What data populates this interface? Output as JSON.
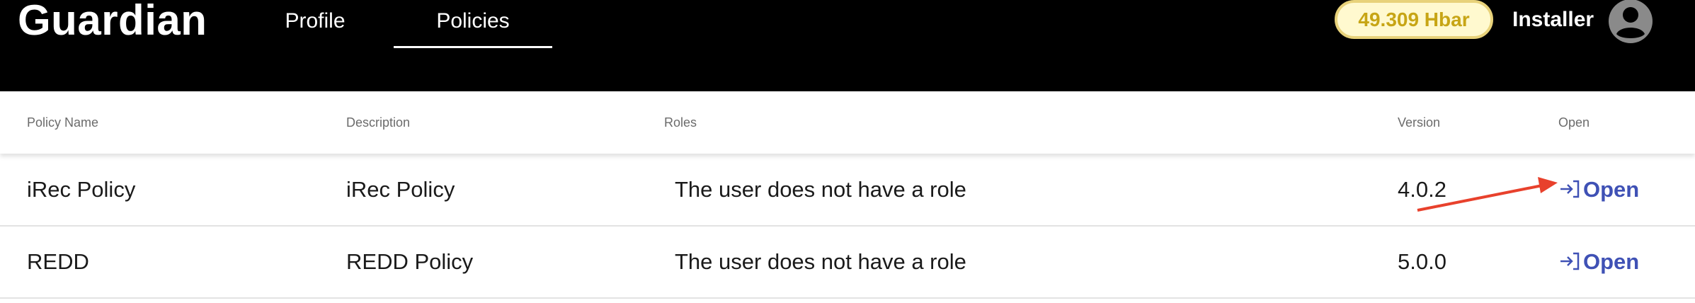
{
  "header": {
    "brand": "Guardian",
    "tabs": [
      {
        "label": "Profile",
        "active": false
      },
      {
        "label": "Policies",
        "active": true
      }
    ],
    "balance": "49.309 Hbar",
    "user_name": "Installer"
  },
  "table": {
    "columns": [
      "Policy Name",
      "Description",
      "Roles",
      "Version",
      "Open"
    ],
    "rows": [
      {
        "name": "iRec Policy",
        "description": "iRec Policy",
        "roles": "The user does not have a role",
        "version": "4.0.2",
        "open_label": "Open"
      },
      {
        "name": "REDD",
        "description": "REDD Policy",
        "roles": "The user does not have a role",
        "version": "5.0.0",
        "open_label": "Open"
      }
    ]
  },
  "colors": {
    "topbar": "#000000",
    "balance_border": "#e8d27a",
    "balance_text": "#c7a515",
    "link": "#3f51b5",
    "annotation_arrow": "#e8412c"
  },
  "icons": {
    "avatar": "account-circle-icon",
    "open": "login-arrow-icon",
    "annotation": "red-arrow-annotation"
  }
}
